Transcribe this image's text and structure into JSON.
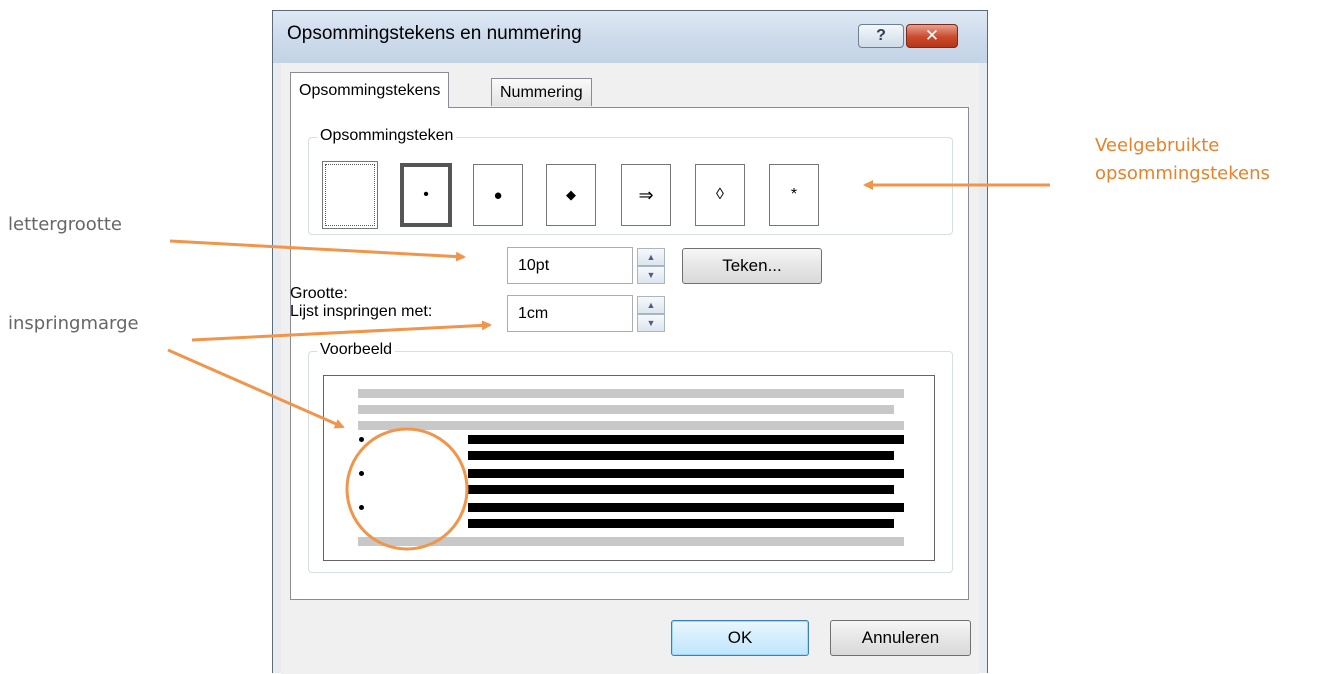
{
  "dialog": {
    "title": "Opsommingstekens en nummering",
    "help_glyph": "?",
    "close_glyph": "✕"
  },
  "tabs": [
    {
      "label": "Opsommingstekens",
      "active": true
    },
    {
      "label": "Nummering",
      "active": false
    }
  ],
  "bullet_group": {
    "label": "Opsommingsteken",
    "options": [
      {
        "glyph": "",
        "name": "none"
      },
      {
        "glyph": "•",
        "name": "small-dot",
        "selected": true
      },
      {
        "glyph": "●",
        "name": "dot"
      },
      {
        "glyph": "◆",
        "name": "diamond"
      },
      {
        "glyph": "⇒",
        "name": "arrow"
      },
      {
        "glyph": "◊",
        "name": "lozenge"
      },
      {
        "glyph": "*",
        "name": "asterisk"
      }
    ]
  },
  "size": {
    "label": "Grootte:",
    "value": "10pt"
  },
  "symbol_button": "Teken...",
  "indent": {
    "label": "Lijst inspringen met:",
    "value": "1cm"
  },
  "preview_group": {
    "label": "Voorbeeld"
  },
  "buttons": {
    "ok": "OK",
    "cancel": "Annuleren"
  },
  "annotations": {
    "font_size": "lettergrootte",
    "indent_margin": "inspringmarge",
    "common_bullets_line1": "Veelgebruikte",
    "common_bullets_line2": "opsommingstekens"
  },
  "colors": {
    "annotation_accent": "#e8812a",
    "annotation_gray": "#666666"
  }
}
